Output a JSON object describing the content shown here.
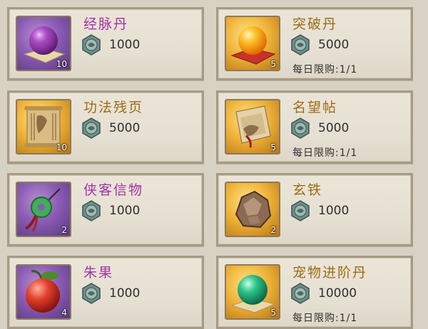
{
  "colors": {
    "purple_name": "#a334a8",
    "gold_name": "#9a6c16",
    "card_bg": "#e8e2d5",
    "card_border": "#a69a86"
  },
  "items": [
    {
      "name": "经脉丹",
      "rarity": "purple",
      "icon": "purple-orb-icon",
      "count": "10",
      "price": "1000",
      "limit": ""
    },
    {
      "name": "突破丹",
      "rarity": "gold",
      "icon": "golden-orb-icon",
      "count": "5",
      "price": "5000",
      "limit": "每日限购:1/1"
    },
    {
      "name": "功法残页",
      "rarity": "gold",
      "icon": "scroll-page-icon",
      "count": "10",
      "price": "5000",
      "limit": ""
    },
    {
      "name": "名望帖",
      "rarity": "gold",
      "icon": "letter-scroll-icon",
      "count": "5",
      "price": "5000",
      "limit": "每日限购:1/1"
    },
    {
      "name": "侠客信物",
      "rarity": "purple",
      "icon": "jade-pendant-icon",
      "count": "2",
      "price": "1000",
      "limit": ""
    },
    {
      "name": "玄铁",
      "rarity": "gold",
      "icon": "iron-ore-icon",
      "count": "2",
      "price": "1000",
      "limit": ""
    },
    {
      "name": "朱果",
      "rarity": "purple",
      "icon": "red-fruit-icon",
      "count": "4",
      "price": "1000",
      "limit": ""
    },
    {
      "name": "宠物进阶丹",
      "rarity": "gold",
      "icon": "green-orb-icon",
      "count": "5",
      "price": "10000",
      "limit": "每日限购:1/1"
    }
  ],
  "currency_icon": "jade-coin-icon"
}
